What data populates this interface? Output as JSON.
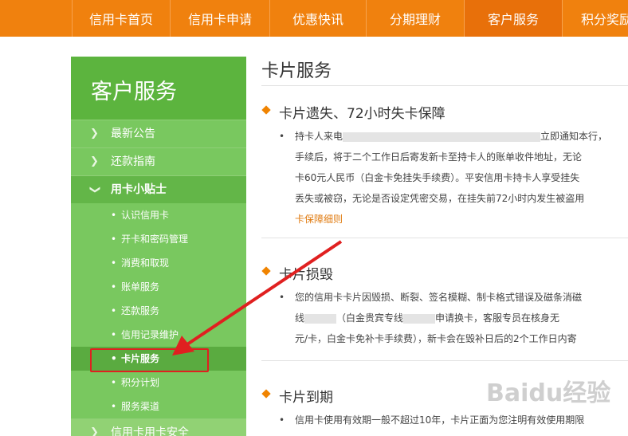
{
  "nav": {
    "items": [
      {
        "label": "信用卡首页"
      },
      {
        "label": "信用卡申请"
      },
      {
        "label": "优惠快讯"
      },
      {
        "label": "分期理财"
      },
      {
        "label": "客户服务"
      },
      {
        "label": "积分奖励"
      }
    ],
    "active_index": 4,
    "accent_color": "#f0810e"
  },
  "sidebar": {
    "title": "客户服务",
    "items": [
      {
        "label": "最新公告"
      },
      {
        "label": "还款指南"
      },
      {
        "label": "用卡小贴士"
      }
    ],
    "subitems": [
      {
        "label": "认识信用卡"
      },
      {
        "label": "开卡和密码管理"
      },
      {
        "label": "消费和取现"
      },
      {
        "label": "账单服务"
      },
      {
        "label": "还款服务"
      },
      {
        "label": "信用记录维护"
      },
      {
        "label": "卡片服务"
      },
      {
        "label": "积分计划"
      },
      {
        "label": "服务渠道"
      }
    ],
    "bottom_item": "信用卡用卡安全",
    "bullet": "•",
    "chevron": "❯",
    "brand_green": "#5cb43e"
  },
  "content": {
    "page_title": "卡片服务",
    "sections": [
      {
        "title": "卡片遗失、72小时失卡保障",
        "lines": [
          "持卡人来电",
          "立即通知本行，",
          "手续后，将于二个工作日后寄发新卡至持卡人的账单收件地址，无论",
          "卡60元人民币（白金卡免挂失手续费）。平安信用卡持卡人享受挂失",
          "丢失或被窃，无论是否设定凭密交易，在挂失前72小时内发生被盗用"
        ],
        "link": "卡保障细则"
      },
      {
        "title": "卡片损毁",
        "lines": [
          "您的信用卡卡片因毁损、断裂、签名模糊、制卡格式错误及磁条消磁",
          "线",
          "（白金贵宾专线",
          "申请换卡，客服专员在核身无",
          "元/卡，白金卡免补卡手续费），新卡会在毁补日后的2个工作日内寄"
        ]
      },
      {
        "title": "卡片到期",
        "lines": [
          "信用卡使用有效期一般不超过10年，卡片正面为您注明有效使用期限"
        ]
      }
    ],
    "bullet": "•"
  },
  "watermark": "Baidu经验"
}
